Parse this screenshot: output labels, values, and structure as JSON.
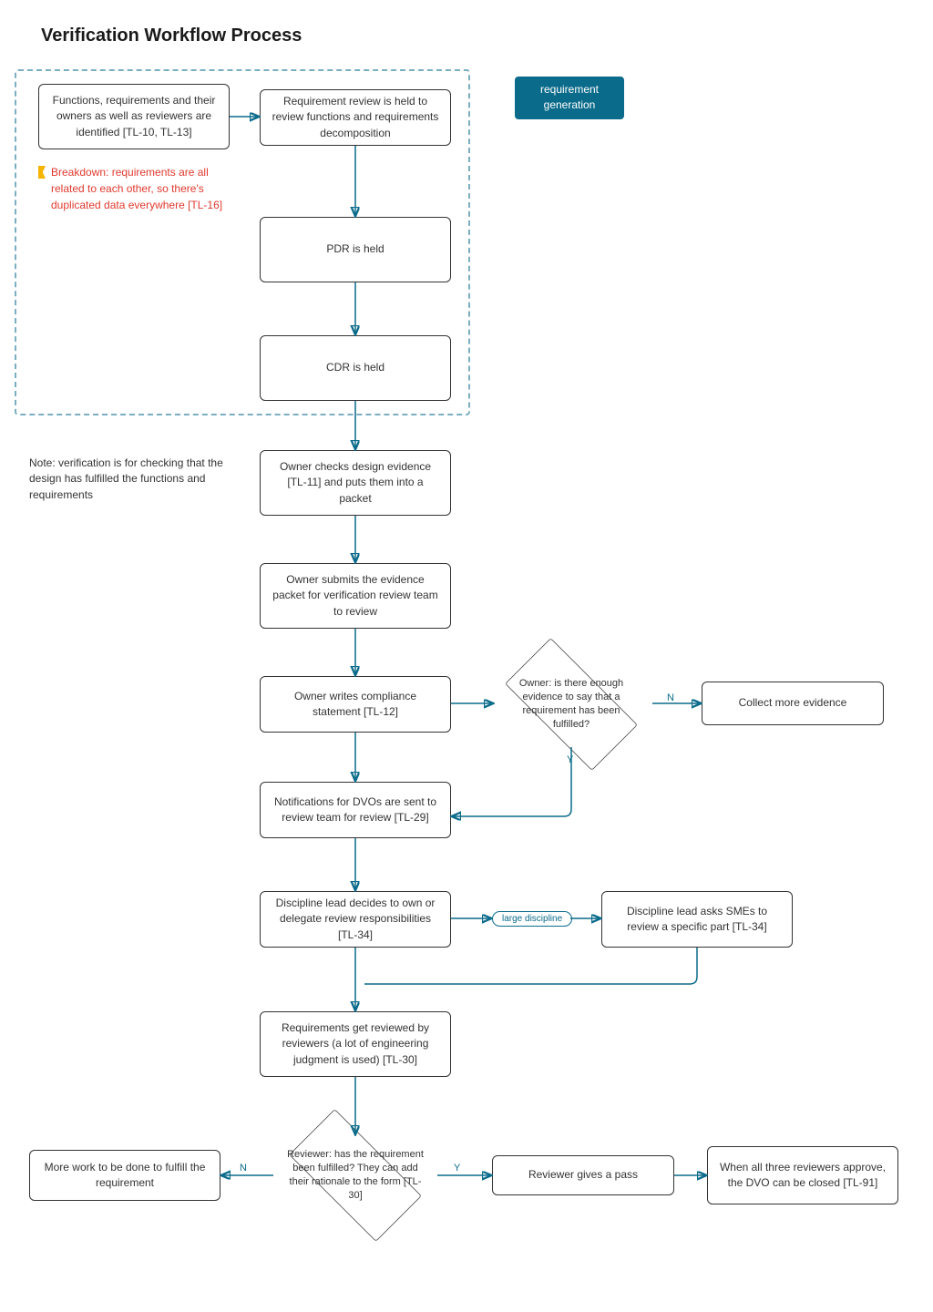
{
  "title": "Verification Workflow Process",
  "tag_req_gen": "requirement generation",
  "n1": "Functions, requirements and their owners as well as reviewers are identified [TL-10, TL-13]",
  "breakdown": "Breakdown: requirements are all related to each other, so there's duplicated data everywhere [TL-16]",
  "n2": "Requirement review is held to review functions and requirements decomposition",
  "n3": "PDR is held",
  "n4": "CDR is held",
  "note": "Note: verification is for checking that the design has fulfilled the functions and requirements",
  "n5": "Owner checks design evidence [TL-11] and puts them into a packet",
  "n6": "Owner submits the evidence packet for verification review team to review",
  "n7": "Owner writes compliance statement [TL-12]",
  "d1": "Owner: is there enough evidence to say that a requirement has been fulfilled?",
  "n8": "Collect more evidence",
  "n9": "Notifications for DVOs are sent to review team for review [TL-29]",
  "n10": "Discipline lead decides to own or delegate review responsibilities [TL-34]",
  "pill": "large discipline",
  "n11": "Discipline lead asks SMEs to review a specific part [TL-34]",
  "n12": "Requirements get reviewed by reviewers (a lot of engineering judgment is used) [TL-30]",
  "d2": "Reviewer: has the requirement been fulfilled? They can add their rationale to the form [TL-30]",
  "n13": "More work to be done to fulfill the requirement",
  "n14": "Reviewer gives a pass",
  "n15": "When all three reviewers approve, the DVO can be closed [TL-91]",
  "labels": {
    "Y": "Y",
    "N": "N"
  }
}
